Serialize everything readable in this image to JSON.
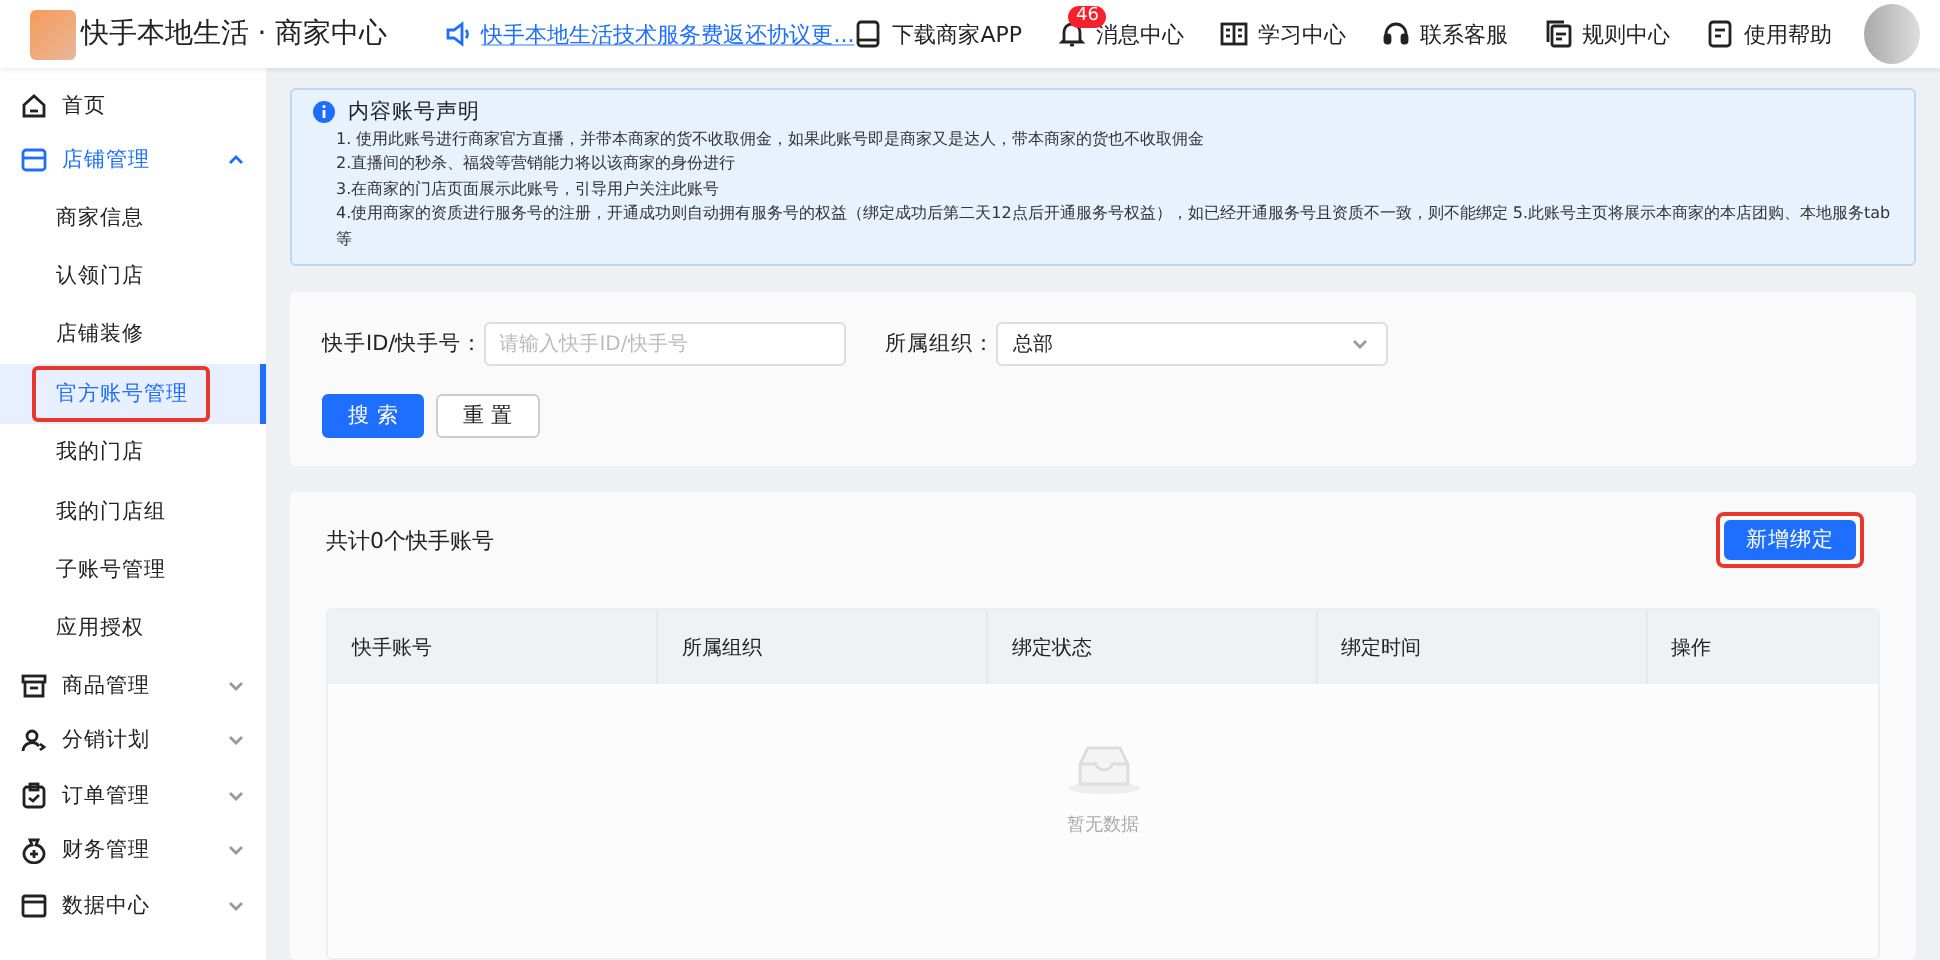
{
  "header": {
    "brand": "快手本地生活 · 商家中心",
    "notice": "快手本地生活技术服务费返还协议更...",
    "nav": [
      {
        "kind": "app",
        "label": "下载商家APP"
      },
      {
        "kind": "bell",
        "label": "消息中心",
        "badge": "46"
      },
      {
        "kind": "book",
        "label": "学习中心"
      },
      {
        "kind": "headset",
        "label": "联系客服"
      },
      {
        "kind": "rules",
        "label": "规则中心"
      },
      {
        "kind": "help",
        "label": "使用帮助"
      }
    ]
  },
  "sidebar": {
    "items": [
      {
        "kind": "home",
        "label": "首页"
      },
      {
        "kind": "store",
        "label": "店铺管理",
        "expanded": true,
        "children": [
          {
            "label": "商家信息",
            "selected": false,
            "highlighted": false
          },
          {
            "label": "认领门店",
            "selected": false,
            "highlighted": false
          },
          {
            "label": "店铺装修",
            "selected": false,
            "highlighted": false
          },
          {
            "label": "官方账号管理",
            "selected": true,
            "highlighted": true
          },
          {
            "label": "我的门店",
            "selected": false,
            "highlighted": false
          },
          {
            "label": "我的门店组",
            "selected": false,
            "highlighted": false
          },
          {
            "label": "子账号管理",
            "selected": false,
            "highlighted": false
          },
          {
            "label": "应用授权",
            "selected": false,
            "highlighted": false
          }
        ]
      },
      {
        "kind": "goods",
        "label": "商品管理",
        "expanded": false
      },
      {
        "kind": "user",
        "label": "分销计划",
        "expanded": false
      },
      {
        "kind": "order",
        "label": "订单管理",
        "expanded": false
      },
      {
        "kind": "finance",
        "label": "财务管理",
        "expanded": false
      },
      {
        "kind": "data",
        "label": "数据中心",
        "expanded": false
      }
    ]
  },
  "notice_box": {
    "title": "内容账号声明",
    "lines": [
      "1. 使用此账号进行商家官方直播，并带本商家的货不收取佣金，如果此账号即是商家又是达人，带本商家的货也不收取佣金",
      "2.直播间的秒杀、福袋等营销能力将以该商家的身份进行",
      "3.在商家的门店页面展示此账号，引导用户关注此账号",
      "4.使用商家的资质进行服务号的注册，开通成功则自动拥有服务号的权益（绑定成功后第二天12点后开通服务号权益），如已经开通服务号且资质不一致，则不能绑定 5.此账号主页将展示本商家的本店团购、本地服务tab等"
    ]
  },
  "search": {
    "fields": [
      {
        "kind": "input",
        "label": "快手ID/快手号：",
        "placeholder": "请输入快手ID/快手号"
      },
      {
        "kind": "select",
        "label": "所属组织：",
        "value": "总部"
      }
    ],
    "buttons": [
      {
        "label": "搜 索",
        "primary": true
      },
      {
        "label": "重 置",
        "primary": false
      }
    ]
  },
  "list": {
    "count": "共计0个快手账号",
    "add_button": {
      "label": "新增绑定",
      "highlighted": true
    },
    "table": {
      "columns": [
        "快手账号",
        "所属组织",
        "绑定状态",
        "绑定时间",
        "操作"
      ],
      "empty": "暂无数据"
    }
  }
}
